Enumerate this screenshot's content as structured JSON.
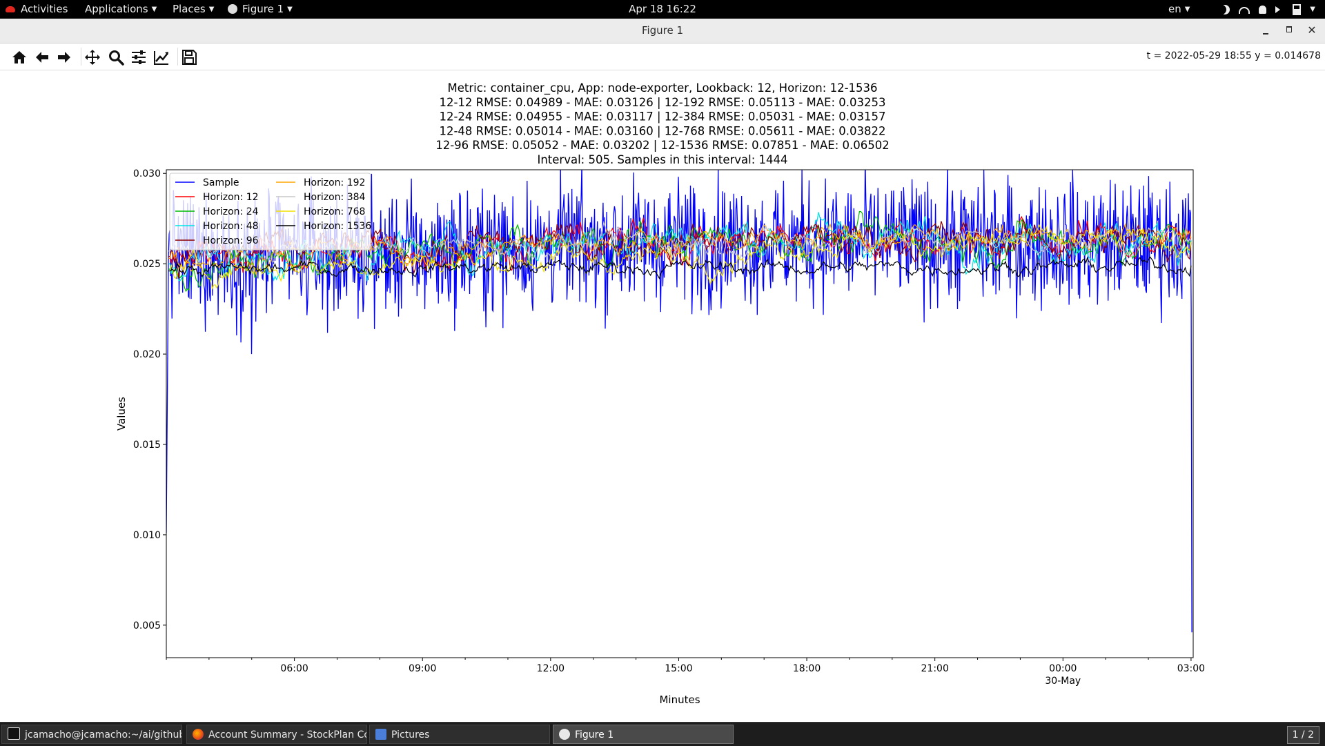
{
  "topbar": {
    "activities": "Activities",
    "applications": "Applications",
    "places": "Places",
    "figure_menu": "Figure 1",
    "clock": "Apr 18  16:22",
    "lang": "en"
  },
  "window": {
    "title": "Figure 1"
  },
  "toolbar": {
    "buttons": [
      "home-icon",
      "back-icon",
      "forward-icon",
      "pan-icon",
      "zoom-icon",
      "subplots-icon",
      "edit-curves-icon",
      "save-icon"
    ],
    "coords": "t = 2022-05-29 18:55  y = 0.014678"
  },
  "taskbar": {
    "tasks": [
      {
        "label": "jcamacho@jcamacho:~/ai/github/...",
        "icon": "terminal-icon"
      },
      {
        "label": "Account Summary - StockPlan Co...",
        "icon": "firefox-icon"
      },
      {
        "label": "Pictures",
        "icon": "files-icon"
      },
      {
        "label": "Figure 1",
        "icon": "figure-icon"
      }
    ],
    "pager": "1 / 2"
  },
  "chart_data": {
    "type": "line",
    "title_lines": [
      "Metric: container_cpu, App: node-exporter, Lookback: 12, Horizon: 12-1536",
      "12-12 RMSE: 0.04989 - MAE: 0.03126 | 12-192 RMSE: 0.05113 - MAE: 0.03253",
      "12-24 RMSE: 0.04955 - MAE: 0.03117 | 12-384 RMSE: 0.05031 - MAE: 0.03157",
      "12-48 RMSE: 0.05014 - MAE: 0.03160 | 12-768 RMSE: 0.05611 - MAE: 0.03822",
      "12-96 RMSE: 0.05052 - MAE: 0.03202 | 12-1536 RMSE: 0.07851 - MAE: 0.06502",
      "Interval: 505. Samples in this interval: 1444"
    ],
    "xlabel": "Minutes",
    "ylabel": "Values",
    "x_range_hours": [
      3.0,
      27.05
    ],
    "xticks": [
      {
        "hour": 6,
        "label": "06:00"
      },
      {
        "hour": 9,
        "label": "09:00"
      },
      {
        "hour": 12,
        "label": "12:00"
      },
      {
        "hour": 15,
        "label": "15:00"
      },
      {
        "hour": 18,
        "label": "18:00"
      },
      {
        "hour": 21,
        "label": "21:00"
      },
      {
        "hour": 24,
        "label": "00:00",
        "sublabel": "30-May"
      },
      {
        "hour": 27,
        "label": "03:00"
      }
    ],
    "ylim": [
      0.0032,
      0.0302
    ],
    "yticks": [
      {
        "value": 0.005,
        "label": "0.005"
      },
      {
        "value": 0.01,
        "label": "0.010"
      },
      {
        "value": 0.015,
        "label": "0.015"
      },
      {
        "value": 0.02,
        "label": "0.020"
      },
      {
        "value": 0.025,
        "label": "0.025"
      },
      {
        "value": 0.03,
        "label": "0.030"
      }
    ],
    "grid": false,
    "legend": {
      "placement": "upper-left",
      "columns": 2
    },
    "series": [
      {
        "name": "Sample",
        "color": "#0000ff",
        "profile": [
          [
            3.0,
            0.0101
          ],
          [
            3.05,
            0.0255
          ],
          [
            8.0,
            0.0255
          ],
          [
            14.0,
            0.0262
          ],
          [
            20.0,
            0.0262
          ],
          [
            27.0,
            0.0262
          ],
          [
            27.02,
            0.0046
          ]
        ],
        "noise": 0.0017,
        "spikes": [
          [
            5.0,
            0.02
          ],
          [
            5.1,
            0.0218
          ],
          [
            15.35,
            0.0292
          ],
          [
            14.8,
            0.0289
          ]
        ]
      },
      {
        "name": "Horizon: 12",
        "color": "#ff0000",
        "profile": [
          [
            3.05,
            0.0253
          ],
          [
            8.0,
            0.0257
          ],
          [
            14.0,
            0.0263
          ],
          [
            20.0,
            0.0265
          ],
          [
            27.0,
            0.0262
          ]
        ],
        "noise": 0.0003
      },
      {
        "name": "Horizon: 24",
        "color": "#00bb00",
        "profile": [
          [
            3.05,
            0.0247
          ],
          [
            8.0,
            0.0255
          ],
          [
            14.0,
            0.0263
          ],
          [
            20.0,
            0.0264
          ],
          [
            27.0,
            0.0262
          ]
        ],
        "noise": 0.0003
      },
      {
        "name": "Horizon: 48",
        "color": "#00e5e5",
        "profile": [
          [
            3.05,
            0.025
          ],
          [
            8.0,
            0.0256
          ],
          [
            14.0,
            0.0266
          ],
          [
            20.0,
            0.0265
          ],
          [
            27.0,
            0.0263
          ]
        ],
        "noise": 0.0003
      },
      {
        "name": "Horizon: 96",
        "color": "#8b0000",
        "profile": [
          [
            3.05,
            0.0254
          ],
          [
            8.0,
            0.0258
          ],
          [
            14.0,
            0.0263
          ],
          [
            20.0,
            0.0264
          ],
          [
            27.0,
            0.0262
          ]
        ],
        "noise": 0.0003
      },
      {
        "name": "Horizon: 192",
        "color": "#ffa500",
        "profile": [
          [
            3.05,
            0.0253
          ],
          [
            8.0,
            0.0257
          ],
          [
            14.0,
            0.0264
          ],
          [
            20.0,
            0.0265
          ],
          [
            27.0,
            0.0264
          ]
        ],
        "noise": 0.0002
      },
      {
        "name": "Horizon: 384",
        "color": "#c8c8c8",
        "profile": [
          [
            3.05,
            0.0257
          ],
          [
            8.0,
            0.0259
          ],
          [
            14.0,
            0.0262
          ],
          [
            20.0,
            0.0264
          ],
          [
            27.0,
            0.0263
          ]
        ],
        "noise": 0.0002
      },
      {
        "name": "Horizon: 768",
        "color": "#f0e000",
        "profile": [
          [
            3.05,
            0.0246
          ],
          [
            8.0,
            0.0251
          ],
          [
            14.0,
            0.0253
          ],
          [
            16.0,
            0.0254
          ],
          [
            18.0,
            0.0262
          ],
          [
            27.0,
            0.0262
          ]
        ],
        "noise": 0.0002
      },
      {
        "name": "Horizon: 1536",
        "color": "#000000",
        "profile": [
          [
            3.05,
            0.0246
          ],
          [
            8.0,
            0.0248
          ],
          [
            14.0,
            0.0248
          ],
          [
            20.0,
            0.0248
          ],
          [
            27.0,
            0.0249
          ]
        ],
        "noise": 0.00012
      }
    ]
  }
}
